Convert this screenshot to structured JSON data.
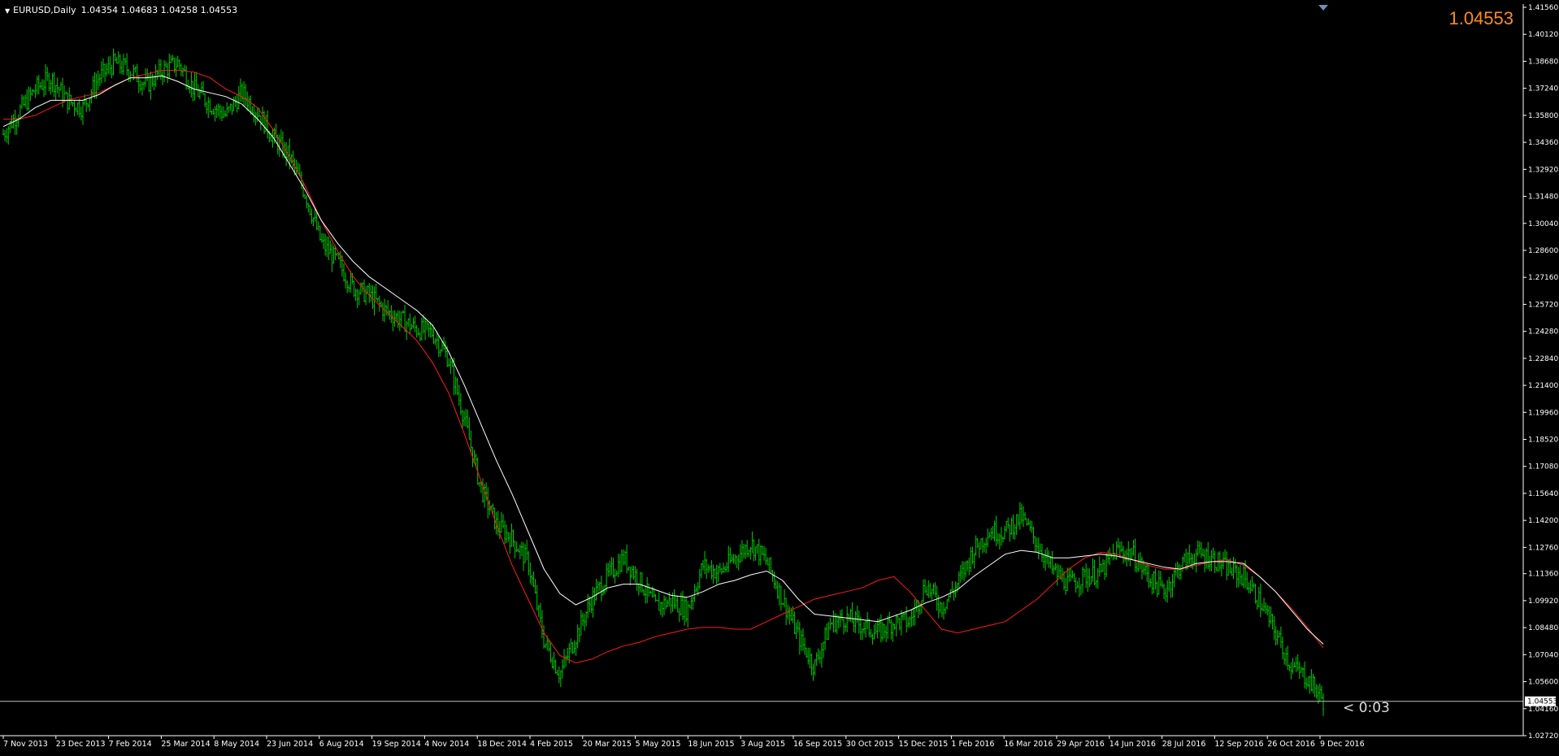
{
  "header": {
    "symbol": "EURUSD,Daily",
    "ohlc": "1.04354 1.04683 1.04258 1.04553"
  },
  "current_price": "1.04553",
  "bar_timer": "< 0:03",
  "colors": {
    "background": "#000000",
    "bars": "#00cc00",
    "ma_fast": "#ffffff",
    "ma_slow": "#ff1a1a",
    "price_line": "#c0c0c0",
    "big_price": "#ff8c1a",
    "axis": "#ffffff"
  },
  "chart_data": {
    "type": "line",
    "title": "EURUSD,Daily",
    "xlabel": "",
    "ylabel": "",
    "ylim": [
      1.0272,
      1.4156
    ],
    "grid": false,
    "y_ticks": [
      "1.41560",
      "1.40120",
      "1.38680",
      "1.37240",
      "1.35800",
      "1.34360",
      "1.32920",
      "1.31480",
      "1.30040",
      "1.28600",
      "1.27160",
      "1.25720",
      "1.24280",
      "1.22840",
      "1.21400",
      "1.19960",
      "1.18520",
      "1.17080",
      "1.15640",
      "1.14200",
      "1.12760",
      "1.11360",
      "1.09920",
      "1.08480",
      "1.07040",
      "1.05600",
      "1.04160",
      "1.02720"
    ],
    "x_ticks": [
      "7 Nov 2013",
      "23 Dec 2013",
      "7 Feb 2014",
      "25 Mar 2014",
      "8 May 2014",
      "23 Jun 2014",
      "6 Aug 2014",
      "19 Sep 2014",
      "4 Nov 2014",
      "18 Dec 2014",
      "4 Feb 2015",
      "20 Mar 2015",
      "5 May 2015",
      "18 Jun 2015",
      "3 Aug 2015",
      "16 Sep 2015",
      "30 Oct 2015",
      "15 Dec 2015",
      "1 Feb 2016",
      "16 Mar 2016",
      "29 Apr 2016",
      "14 Jun 2016",
      "28 Jul 2016",
      "12 Sep 2016",
      "26 Oct 2016",
      "9 Dec 2016"
    ],
    "price_label": "1.04553",
    "series": [
      {
        "kind": "close",
        "values": [
          1.348,
          1.36,
          1.372,
          1.378,
          1.366,
          1.362,
          1.378,
          1.386,
          1.382,
          1.374,
          1.382,
          1.386,
          1.372,
          1.364,
          1.358,
          1.37,
          1.36,
          1.346,
          1.336,
          1.316,
          1.29,
          1.28,
          1.266,
          1.262,
          1.254,
          1.249,
          1.244,
          1.242,
          1.228,
          1.196,
          1.16,
          1.14,
          1.132,
          1.12,
          1.078,
          1.06,
          1.08,
          1.1,
          1.112,
          1.122,
          1.11,
          1.096,
          1.099,
          1.094,
          1.118,
          1.114,
          1.122,
          1.13,
          1.12,
          1.1,
          1.08,
          1.064,
          1.087,
          1.09,
          1.086,
          1.082,
          1.088,
          1.088,
          1.108,
          1.096,
          1.108,
          1.126,
          1.136,
          1.136,
          1.144,
          1.13,
          1.115,
          1.108,
          1.112,
          1.114,
          1.126,
          1.124,
          1.112,
          1.104,
          1.118,
          1.124,
          1.122,
          1.116,
          1.112,
          1.099,
          1.082,
          1.064,
          1.058,
          1.046
        ]
      },
      {
        "kind": "ma_fast",
        "values": [
          1.352,
          1.356,
          1.362,
          1.366,
          1.366,
          1.366,
          1.369,
          1.374,
          1.378,
          1.378,
          1.379,
          1.376,
          1.372,
          1.37,
          1.368,
          1.364,
          1.356,
          1.346,
          1.332,
          1.318,
          1.302,
          1.29,
          1.28,
          1.272,
          1.266,
          1.26,
          1.254,
          1.246,
          1.232,
          1.214,
          1.194,
          1.174,
          1.156,
          1.136,
          1.116,
          1.103,
          1.097,
          1.101,
          1.106,
          1.108,
          1.108,
          1.105,
          1.102,
          1.101,
          1.104,
          1.108,
          1.11,
          1.113,
          1.115,
          1.11,
          1.1,
          1.092,
          1.091,
          1.09,
          1.089,
          1.088,
          1.091,
          1.094,
          1.098,
          1.101,
          1.105,
          1.112,
          1.118,
          1.124,
          1.126,
          1.125,
          1.122,
          1.122,
          1.123,
          1.124,
          1.123,
          1.121,
          1.119,
          1.117,
          1.116,
          1.119,
          1.12,
          1.12,
          1.119,
          1.112,
          1.104,
          1.094,
          1.084,
          1.076
        ]
      },
      {
        "kind": "ma_slow",
        "values": [
          1.356,
          1.356,
          1.358,
          1.362,
          1.366,
          1.368,
          1.37,
          1.374,
          1.378,
          1.38,
          1.382,
          1.382,
          1.381,
          1.378,
          1.372,
          1.368,
          1.362,
          1.35,
          1.336,
          1.32,
          1.302,
          1.286,
          1.272,
          1.262,
          1.254,
          1.246,
          1.238,
          1.226,
          1.21,
          1.188,
          1.164,
          1.14,
          1.118,
          1.1,
          1.082,
          1.07,
          1.066,
          1.068,
          1.072,
          1.075,
          1.077,
          1.08,
          1.082,
          1.084,
          1.085,
          1.085,
          1.084,
          1.084,
          1.088,
          1.092,
          1.096,
          1.1,
          1.102,
          1.104,
          1.106,
          1.11,
          1.112,
          1.104,
          1.094,
          1.084,
          1.082,
          1.084,
          1.086,
          1.088,
          1.094,
          1.1,
          1.108,
          1.116,
          1.122,
          1.125,
          1.124,
          1.121,
          1.118,
          1.116,
          1.116,
          1.118,
          1.12,
          1.121,
          1.118,
          1.112,
          1.104,
          1.095,
          1.085,
          1.074
        ]
      }
    ]
  }
}
